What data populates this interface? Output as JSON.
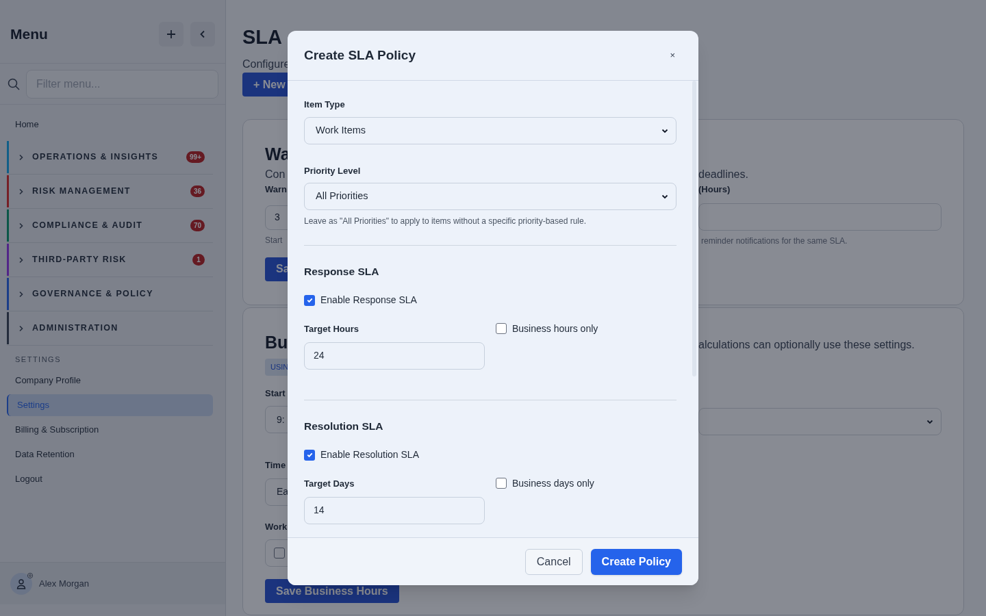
{
  "sidebar": {
    "title": "Menu",
    "search": {
      "placeholder": "Filter menu..."
    },
    "home": "Home",
    "groups": [
      {
        "label": "OPERATIONS & INSIGHTS",
        "badge": "99+",
        "color": "#105e88"
      },
      {
        "label": "RISK MANAGEMENT",
        "badge": "36",
        "color": "#761f26"
      },
      {
        "label": "COMPLIANCE & AUDIT",
        "badge": "70",
        "color": "#0b5748"
      },
      {
        "label": "THIRD-PARTY RISK",
        "badge": "1",
        "color": "#522588"
      },
      {
        "label": "GOVERNANCE & POLICY",
        "color": "#1b3d89"
      },
      {
        "label": "ADMINISTRATION",
        "color": "#242c3c"
      }
    ],
    "settings_heading": "SETTINGS",
    "settings_items": [
      {
        "label": "Company Profile",
        "selected": false
      },
      {
        "label": "Settings",
        "selected": true
      },
      {
        "label": "Billing & Subscription",
        "selected": false
      },
      {
        "label": "Data Retention",
        "selected": false
      },
      {
        "label": "Logout",
        "selected": false
      }
    ],
    "user": "Alex Morgan"
  },
  "main": {
    "title": "SLA",
    "subtitle": "Configure",
    "new_button": "+ New",
    "warning_card": {
      "heading": "Wa",
      "description_left": "Con",
      "description_right": "deadlines.",
      "label_left": "Warn",
      "label_right": "(Hours)",
      "value": "3",
      "help_left": "Start",
      "help_right": "reminder notifications for the same SLA.",
      "button": "Sa"
    },
    "hours_card": {
      "heading": "Bu",
      "description_right": "alculations can optionally use these settings.",
      "badge": "USIN",
      "start_label": "Start",
      "start_value": "9:",
      "timezone_label": "Time",
      "timezone_value": "Ea",
      "workdays_label": "Work",
      "workday_checked": false,
      "button": "Save Business Hours"
    }
  },
  "modal": {
    "title": "Create SLA Policy",
    "close": "×",
    "item_type": {
      "label": "Item Type",
      "value": "Work Items"
    },
    "priority": {
      "label": "Priority Level",
      "value": "All Priorities",
      "help": "Leave as \"All Priorities\" to apply to items without a specific priority-based rule."
    },
    "sections": [
      {
        "heading": "Response SLA",
        "enable_label": "Enable Response SLA",
        "enabled": true,
        "target_label": "Target Hours",
        "target_value": "24",
        "business_label": "Business hours only",
        "business_only": false
      },
      {
        "heading": "Resolution SLA",
        "enable_label": "Enable Resolution SLA",
        "enabled": true,
        "target_label": "Target Days",
        "target_value": "14",
        "business_label": "Business days only",
        "business_only": false
      }
    ],
    "cancel": "Cancel",
    "submit": "Create Policy"
  }
}
